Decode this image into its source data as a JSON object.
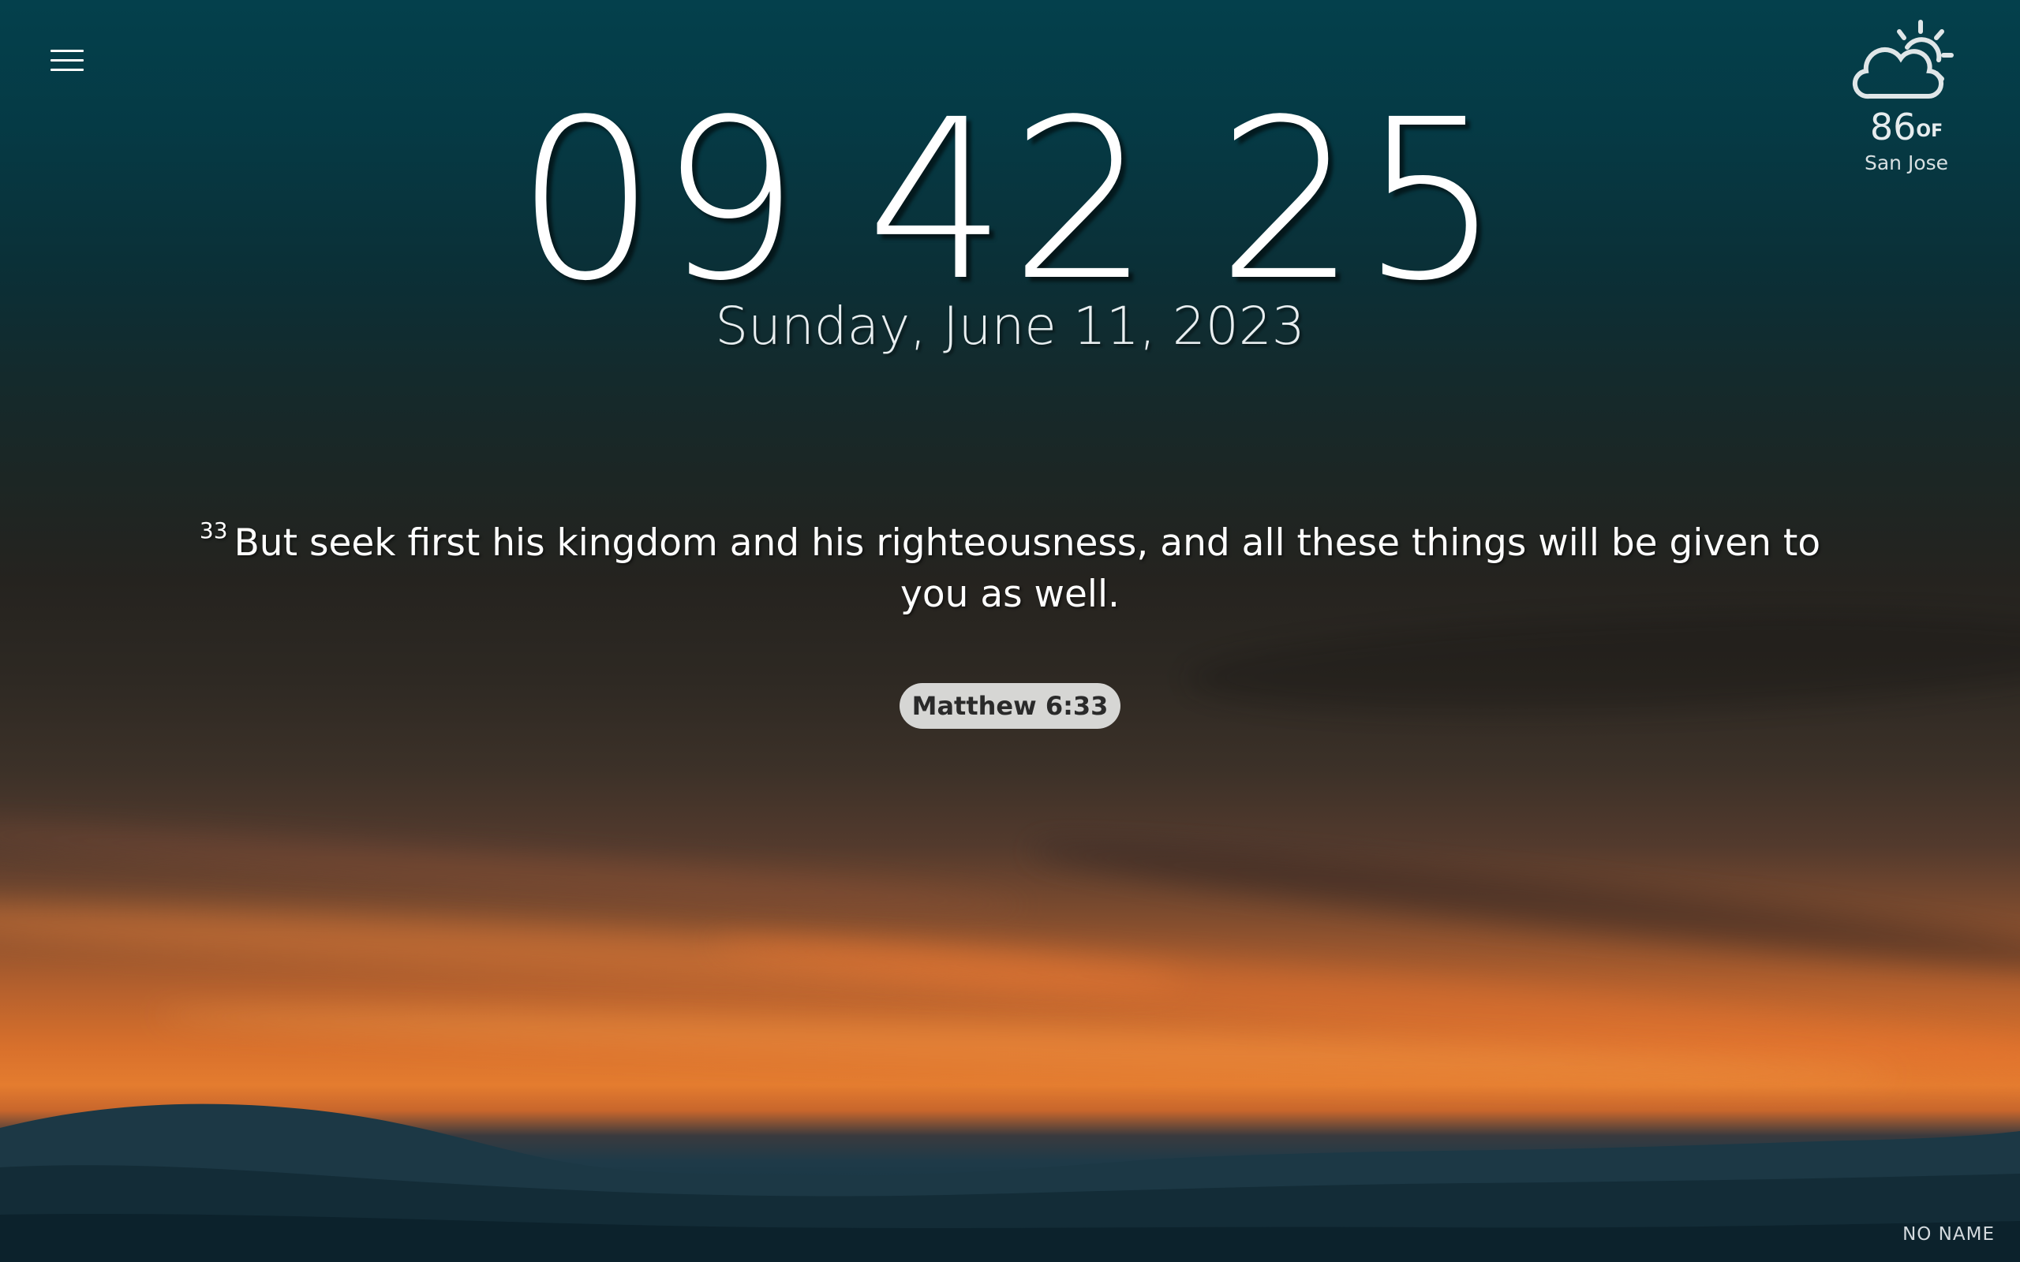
{
  "clock": {
    "hours": "09",
    "minutes": "42",
    "seconds": "25"
  },
  "date": "Sunday, June 11, 2023",
  "weather": {
    "icon": "partly-sunny-icon",
    "temperature": "86",
    "unit": "OF",
    "city": "San Jose"
  },
  "verse": {
    "number": "33",
    "text": "But seek first his kingdom and his righteousness, and all these things will be given to you as well.",
    "reference": "Matthew 6:33"
  },
  "user": {
    "name": "NO NAME"
  },
  "menu": {
    "icon": "hamburger-menu-icon"
  },
  "colors": {
    "sky_top": "#04404c",
    "sunset": "#e47c2f",
    "reference_pill": "#d6d6d4"
  }
}
